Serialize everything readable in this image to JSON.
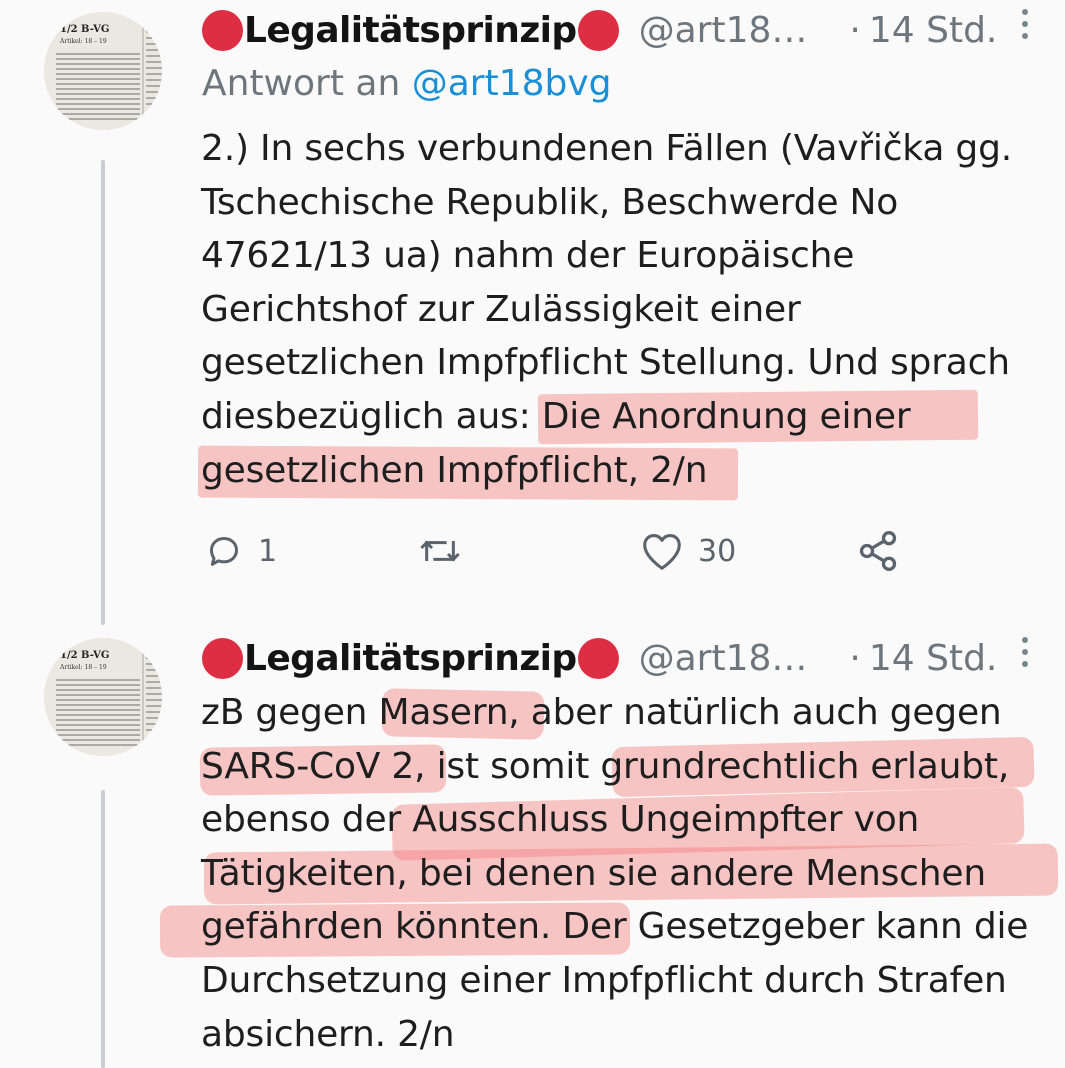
{
  "colors": {
    "accent_link": "#1a8fd6",
    "red_dot": "#dd2e44",
    "highlight": "#f47a7a",
    "secondary_text": "#6e767d"
  },
  "tweets": [
    {
      "avatar_icon": "law-book-page-avatar",
      "avatar_text": "1/2 B-VG",
      "display_name": "Legalitätsprinzip",
      "name_emoji": "red-circle",
      "handle": "@art18…",
      "separator": "·",
      "time": "14 Std.",
      "reply_prefix": "Antwort an",
      "reply_mention": "@art18bvg",
      "lines": [
        "2.) In sechs verbundenen Fällen (Vavřička gg.",
        "Tschechische Republik, Beschwerde No",
        "47621/13 ua) nahm der Europäische",
        "Gerichtshof zur Zulässigkeit einer",
        "gesetzlichen Impfpflicht Stellung. Und sprach",
        "diesbezüglich aus: Die Anordnung einer",
        "gesetzlichen Impfpflicht, 2/n"
      ],
      "actions": {
        "reply_icon": "reply-icon",
        "reply_count": "1",
        "retweet_icon": "retweet-icon",
        "like_icon": "heart-icon",
        "like_count": "30",
        "share_icon": "share-icon"
      }
    },
    {
      "avatar_icon": "law-book-page-avatar",
      "avatar_text": "1/2 B-VG",
      "display_name": "Legalitätsprinzip",
      "name_emoji": "red-circle",
      "handle": "@art18…",
      "separator": "·",
      "time": "14 Std.",
      "lines": [
        "zB gegen Masern, aber natürlich auch gegen",
        "SARS-CoV 2, ist somit grundrechtlich erlaubt,",
        "ebenso der Ausschluss Ungeimpfter von",
        "Tätigkeiten, bei denen sie andere Menschen",
        "gefährden könnten. Der Gesetzgeber kann die",
        "Durchsetzung einer Impfpflicht durch Strafen",
        "absichern. 2/n"
      ]
    }
  ]
}
